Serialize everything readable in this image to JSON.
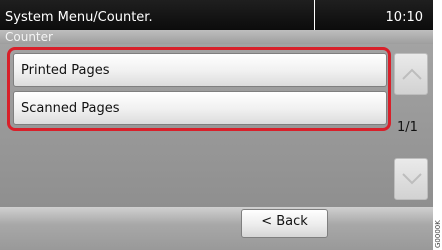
{
  "header": {
    "title": "System Menu/Counter.",
    "time": "10:10"
  },
  "subheader": {
    "label": "Counter"
  },
  "list": {
    "items": [
      {
        "label": "Printed Pages"
      },
      {
        "label": "Scanned Pages"
      }
    ]
  },
  "pager": {
    "indicator": "1/1",
    "up_icon": "chevron-up-icon",
    "down_icon": "chevron-down-icon"
  },
  "footer": {
    "back_label": "< Back"
  },
  "side_code": "G0000K"
}
